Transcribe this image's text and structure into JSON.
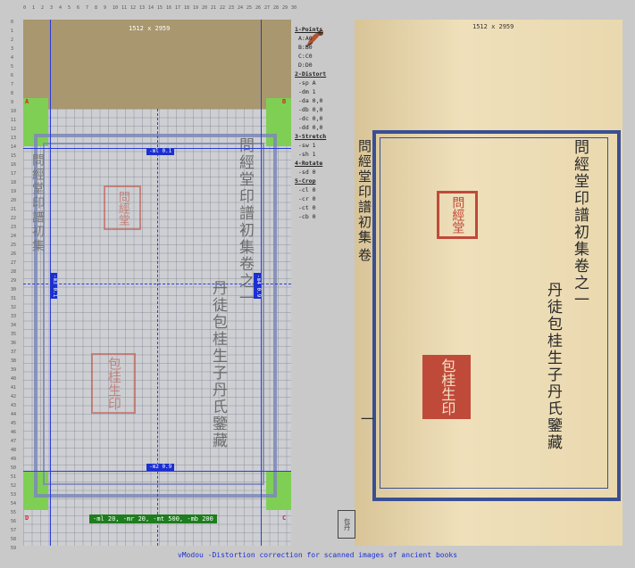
{
  "image_size_label_left": "1512 x 2959",
  "image_size_label_right": "1512 x 2959",
  "ruler_top": [
    "0",
    "1",
    "2",
    "3",
    "4",
    "5",
    "6",
    "7",
    "8",
    "9",
    "10",
    "11",
    "12",
    "13",
    "14",
    "15",
    "16",
    "17",
    "18",
    "19",
    "20",
    "21",
    "22",
    "23",
    "24",
    "25",
    "26",
    "27",
    "28",
    "29",
    "30"
  ],
  "ruler_left": [
    "0",
    "1",
    "2",
    "3",
    "4",
    "5",
    "6",
    "7",
    "8",
    "9",
    "10",
    "11",
    "12",
    "13",
    "14",
    "15",
    "16",
    "17",
    "18",
    "19",
    "20",
    "21",
    "22",
    "23",
    "24",
    "25",
    "26",
    "27",
    "28",
    "29",
    "30",
    "31",
    "32",
    "33",
    "34",
    "35",
    "36",
    "37",
    "38",
    "39",
    "40",
    "41",
    "42",
    "43",
    "44",
    "45",
    "46",
    "47",
    "48",
    "49",
    "50",
    "51",
    "52",
    "53",
    "54",
    "55",
    "56",
    "57",
    "58",
    "59"
  ],
  "corners": {
    "a": "A",
    "b": "B",
    "c": "C",
    "d": "D"
  },
  "guides": {
    "ml_top": "-ml 0.1",
    "m2_bottom": "-m2 0.9",
    "left_vertical": "-m3 0.1",
    "right_vertical": "-m4 0.9"
  },
  "crop_note": "-ml 20, -mr 20, -mt 500, -mb 200",
  "panel": {
    "sections": [
      {
        "title": "1-Points",
        "items": [
          "A:A0",
          "B:B0",
          "C:C0",
          "D:D0"
        ]
      },
      {
        "title": "2-Distort",
        "items": [
          "-sp A",
          "-dm 1",
          "-da 0,0",
          "-db 0,0",
          "-dc 0,0",
          "-dd 0,0"
        ]
      },
      {
        "title": "3-Stretch",
        "items": [
          "-sw 1",
          "-sh 1"
        ]
      },
      {
        "title": "4-Rotate",
        "items": [
          "-sd 0"
        ]
      },
      {
        "title": "5-Crop",
        "items": [
          "-cl 0",
          "-cr 0",
          "-ct 0",
          "-cb 0"
        ]
      }
    ]
  },
  "book": {
    "title_col": "問經堂印譜初集",
    "volume_col": "問經堂印譜初集卷之一",
    "author_col": "丹徒包桂生子丹氏鑒藏",
    "seal_top": "問經堂",
    "seal_bottom": "包桂生印",
    "edge_char": "卷",
    "edge_char2": "一",
    "bottom_seal": "包丹"
  },
  "footer": "vModou -Distortion correction for scanned images of ancient books",
  "colors": {
    "guide_blue": "#2a3bdc",
    "corner_green": "#7fcf55",
    "seal_red": "#c04a3a",
    "footer_blue": "#1d2fd2"
  }
}
